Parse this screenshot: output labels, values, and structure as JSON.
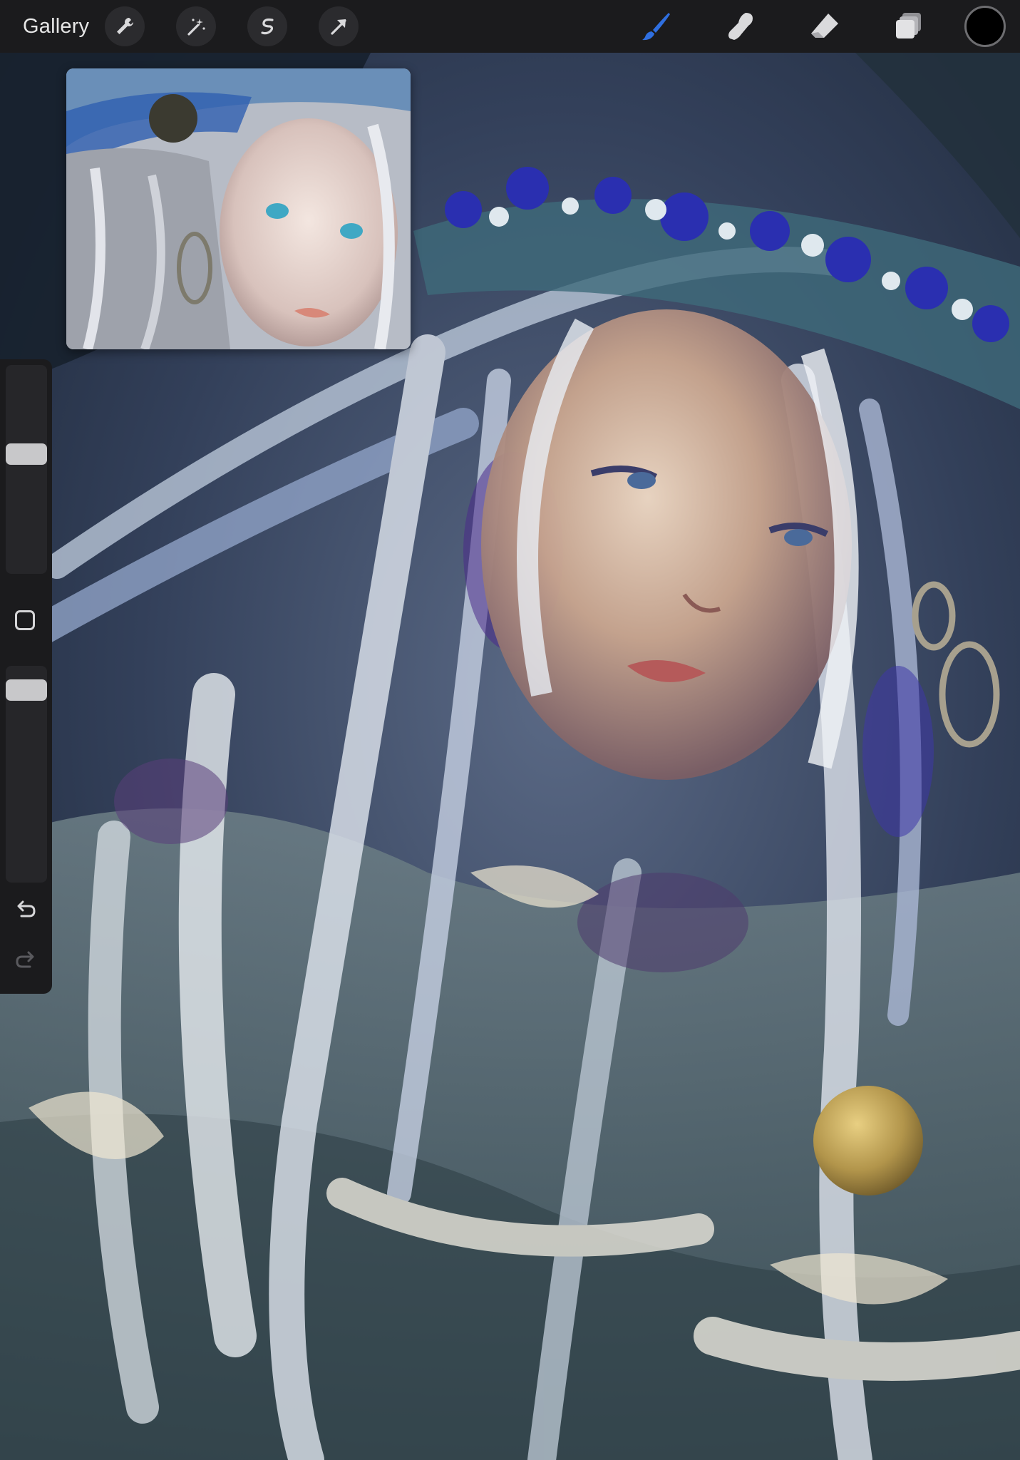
{
  "app": {
    "gallery_label": "Gallery"
  },
  "toolbar": {
    "left_tools": [
      {
        "name": "actions",
        "icon": "wrench-icon"
      },
      {
        "name": "adjustments",
        "icon": "magic-wand-icon"
      },
      {
        "name": "selection",
        "icon": "selection-s-icon"
      },
      {
        "name": "transform",
        "icon": "cursor-arrow-icon"
      }
    ],
    "right_tools": [
      {
        "name": "brush",
        "icon": "brush-icon",
        "active": true
      },
      {
        "name": "smudge",
        "icon": "smudge-icon",
        "active": false
      },
      {
        "name": "eraser",
        "icon": "eraser-icon",
        "active": false
      },
      {
        "name": "layers",
        "icon": "layers-icon",
        "active": false
      }
    ],
    "current_color": "#000000",
    "accent_color": "#2f6fe0"
  },
  "sidebar": {
    "brush_size_level": 0.58,
    "brush_opacity_level": 0.93,
    "modify_icon": "square-icon",
    "undo_icon": "undo-icon",
    "redo_icon": "redo-icon",
    "redo_enabled": false
  },
  "reference": {
    "icon": "reference-image-icon"
  }
}
